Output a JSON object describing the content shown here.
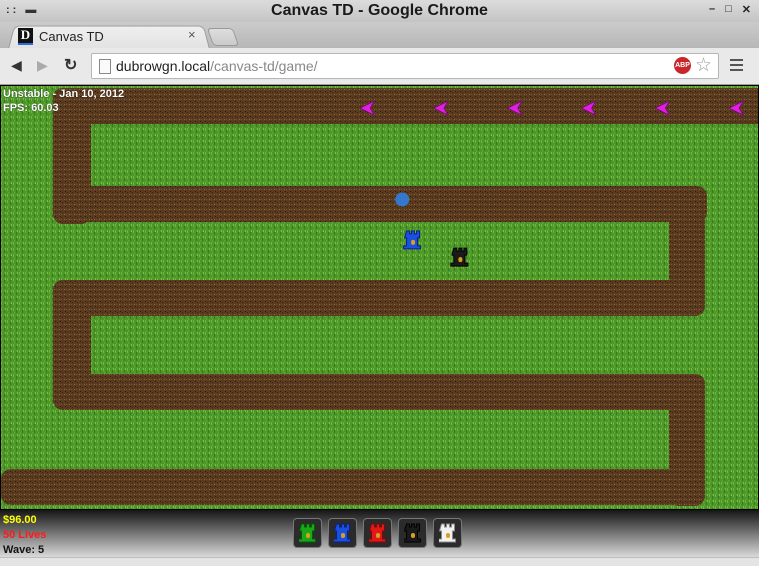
{
  "window": {
    "title": "Canvas TD - Google Chrome",
    "controls": {
      "minimize": "–",
      "maximize": "□",
      "close": "✕"
    }
  },
  "tabs": [
    {
      "title": "Canvas TD",
      "favicon_letter": "D",
      "close": "×",
      "active": true
    }
  ],
  "toolbar": {
    "back_icon": "◀",
    "forward_icon": "▶",
    "reload_icon": "↻",
    "url_host": "dubrowgn.local",
    "url_path": "/canvas-td/game/",
    "abp_label": "ABP",
    "star_icon": "☆"
  },
  "game": {
    "build_label": "Unstable - Jan 10, 2012",
    "fps_label": "FPS: 60.03",
    "money": "$96.00",
    "lives": "50 Lives",
    "wave": "Wave: 5",
    "colors": {
      "grass": "#4f9a2a",
      "dirt": "#5a3a1e",
      "money": "#ffff00",
      "lives": "#ff1a1a",
      "wave": "#111111",
      "enemy": "#e020e0",
      "projectile": "#2f7fe0"
    },
    "map": {
      "grid_cols": 20,
      "grid_rows": 11,
      "enemies": [
        {
          "type": "arrow",
          "col": 9.7,
          "row": 0.55
        },
        {
          "type": "arrow",
          "col": 11.65,
          "row": 0.55
        },
        {
          "type": "arrow",
          "col": 13.6,
          "row": 0.55
        },
        {
          "type": "arrow",
          "col": 15.55,
          "row": 0.55
        },
        {
          "type": "arrow",
          "col": 17.5,
          "row": 0.55
        },
        {
          "type": "arrow",
          "col": 19.45,
          "row": 0.55
        }
      ],
      "projectiles": [
        {
          "col": 10.6,
          "row": 2.95
        }
      ],
      "placed_towers": [
        {
          "color": "blue",
          "col": 10.9,
          "row": 4.0
        },
        {
          "color": "black",
          "col": 12.15,
          "row": 4.45
        }
      ]
    },
    "tower_shop": [
      {
        "name": "green-tower",
        "color": "#18a818",
        "dark": "#0a5a0a"
      },
      {
        "name": "blue-tower",
        "color": "#1a4fe0",
        "dark": "#0a2280"
      },
      {
        "name": "red-tower",
        "color": "#e01818",
        "dark": "#800a0a"
      },
      {
        "name": "black-tower",
        "color": "#1a1a1a",
        "dark": "#000000"
      },
      {
        "name": "white-tower",
        "color": "#f2f2f2",
        "dark": "#8a8a8a"
      }
    ]
  }
}
